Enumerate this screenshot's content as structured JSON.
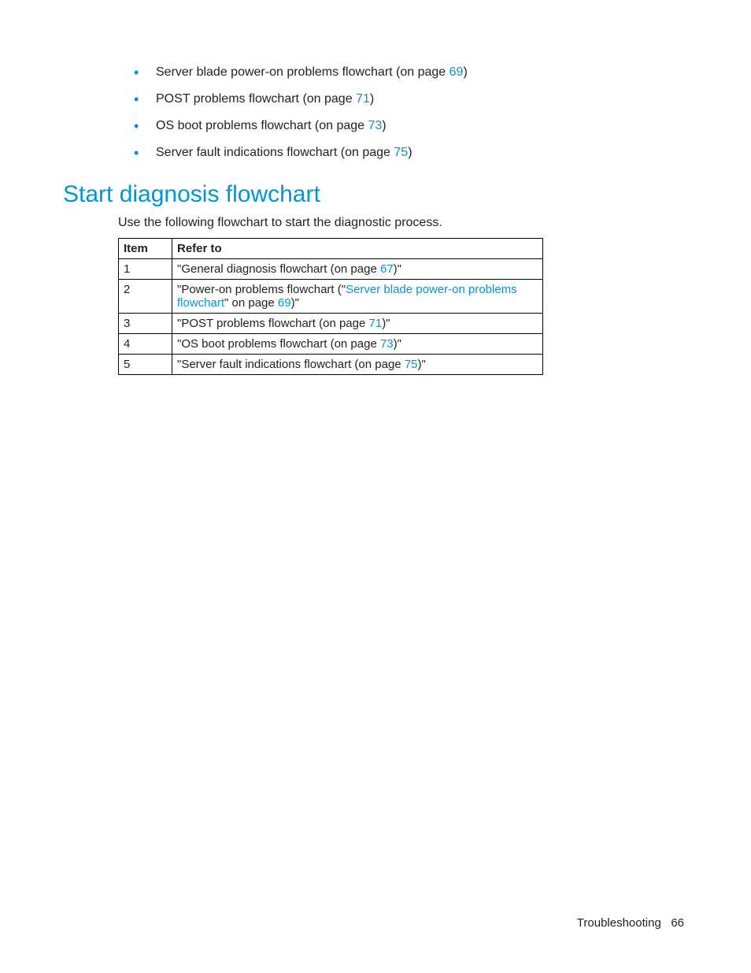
{
  "bullets": [
    {
      "text_before": "Server blade power-on problems flowchart (on page ",
      "link": "69",
      "text_after": ")"
    },
    {
      "text_before": "POST problems flowchart (on page ",
      "link": "71",
      "text_after": ")"
    },
    {
      "text_before": "OS boot problems flowchart (on page ",
      "link": "73",
      "text_after": ")"
    },
    {
      "text_before": "Server fault indications flowchart (on page ",
      "link": "75",
      "text_after": ")"
    }
  ],
  "heading": "Start diagnosis flowchart",
  "intro": "Use the following flowchart to start the diagnostic process.",
  "table": {
    "headers": {
      "item": "Item",
      "refer": "Refer to"
    },
    "rows": [
      {
        "item": "1",
        "segments": [
          {
            "t": "\"General diagnosis flowchart (on page "
          },
          {
            "t": "67",
            "link": true
          },
          {
            "t": ")\""
          }
        ]
      },
      {
        "item": "2",
        "segments": [
          {
            "t": "\"Power-on problems flowchart (\""
          },
          {
            "t": "Server blade power-on problems flowchart",
            "link": true
          },
          {
            "t": "\" on page "
          },
          {
            "t": "69",
            "link": true
          },
          {
            "t": ")\""
          }
        ]
      },
      {
        "item": "3",
        "segments": [
          {
            "t": "\"POST problems flowchart (on page "
          },
          {
            "t": "71",
            "link": true
          },
          {
            "t": ")\""
          }
        ]
      },
      {
        "item": "4",
        "segments": [
          {
            "t": "\"OS boot problems flowchart (on page "
          },
          {
            "t": "73",
            "link": true
          },
          {
            "t": ")\""
          }
        ]
      },
      {
        "item": "5",
        "segments": [
          {
            "t": "\"Server fault indications flowchart (on page "
          },
          {
            "t": "75",
            "link": true
          },
          {
            "t": ")\""
          }
        ]
      }
    ]
  },
  "footer": {
    "section": "Troubleshooting",
    "page": "66"
  }
}
